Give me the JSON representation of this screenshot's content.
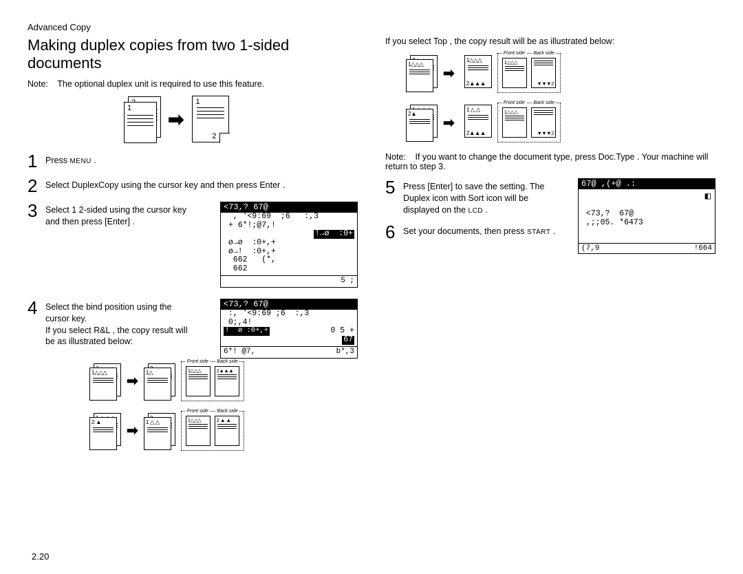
{
  "section": "Advanced Copy",
  "title": "Making duplex copies from two 1-sided documents",
  "note_label": "Note: ",
  "note_text": "The optional duplex unit is required to use this feature.",
  "steps": {
    "s1": {
      "text_a": "Press",
      "text_b": "MENU",
      "text_c": "."
    },
    "s2": {
      "text_a": "Select",
      "key": "DuplexCopy",
      "text_b": " using the cursor key and then press ",
      "key2": "Enter",
      "text_c": "."
    },
    "s3": {
      "text_a": "Select ",
      "key": "1",
      "text_a2": " 2-sided",
      "text_b": " using the cursor key and then press [Enter]",
      "text_c": "."
    },
    "s4": {
      "line1": "Select the bind position using the cursor key.",
      "line2a": "If you select ",
      "key": "R&L",
      "line2b": " , the copy result will be as illustrated below:"
    },
    "colR_top": {
      "text_a": "If you select ",
      "key": "Top",
      "text_b": " , the copy result will be as illustrated below:"
    },
    "colR_note": {
      "label": "Note: ",
      "text_a": "If you want to change the document type, press ",
      "key": "Doc.Type",
      "text_b": " . Your machine will return to step 3."
    },
    "s5": {
      "text_a": "Press [Enter]",
      "text_b": " to save the setting. The ",
      "word": "Duplex",
      "text_c": " icon with  Sort  icon will be displayed on the ",
      "small": "LCD",
      "text_d": "."
    },
    "s6": {
      "text_a": "Set your documents, then press ",
      "small": "START",
      "text_b": "."
    }
  },
  "lcd1": {
    "header": "<73,?   67@",
    "l1": "  , '<9:69  ;6   :,3",
    "l2": " + 6*!;@7,!",
    "hl": "!→ø  :0+",
    "l3": " ø→ø  :0+,+",
    "l4": " ø→!  :0+,+",
    "l5": "  662   (*,",
    "l6": "  662",
    "ftr_r": "5 ;"
  },
  "lcd2": {
    "header": "<73,?   67@",
    "l1": " :, '<9:69 ;6  :,3",
    "l2": " 0;,4!",
    "hl_l": "!  ø :0+,+",
    "hl_r": "0 5 +",
    "box_r": "67",
    "ftr_l": "6*! @7,",
    "ftr_r": "b*,3"
  },
  "lcd3": {
    "header": "  67@     ,(+@   .:",
    "l1": " <73,?  67@",
    "l2": " ,;;05. *6473",
    "ftr_l": "(7,9",
    "ftr_r": "!664"
  },
  "labels": {
    "front": "Front side",
    "back": "Back side"
  },
  "triangles": {
    "up1": "1△△△",
    "up2": "2▲▲▲",
    "dn2": "▼▼▼2",
    "row_a_back_top": "2▲▲▲",
    "row_a_back_top_alt": "2 ▲",
    "row_a_front_top": "1△△△",
    "row_b_back_top": "1 △ △ △",
    "row_b_front_top": "2 ▲"
  },
  "page_number": "2.20"
}
